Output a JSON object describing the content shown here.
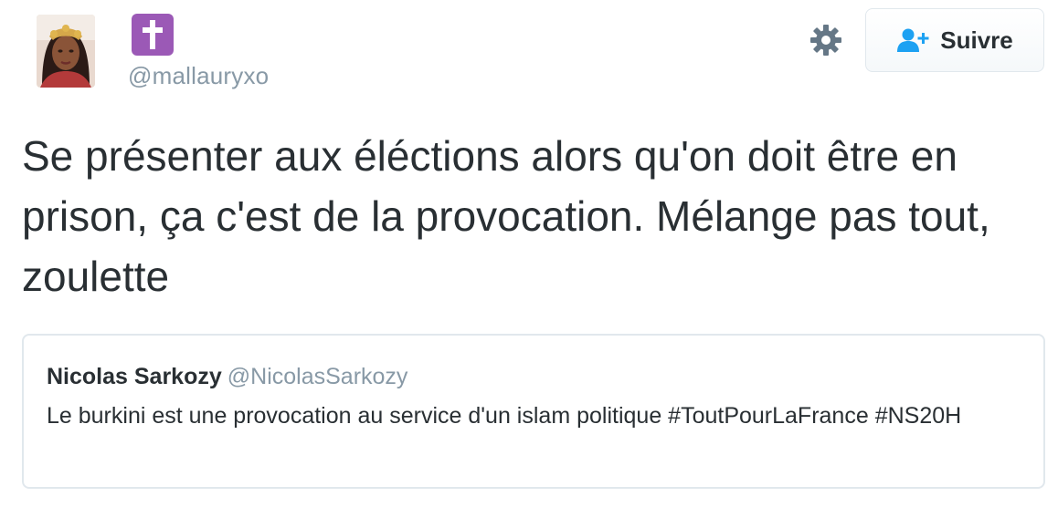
{
  "author": {
    "handle": "@mallauryxo",
    "name_emoji": "latin-cross-emoji"
  },
  "header": {
    "follow_label": "Suivre",
    "settings_icon": "gear-icon",
    "follow_icon": "add-user-icon"
  },
  "tweet": {
    "text": "Se présenter aux éléctions alors qu'on doit être en prison, ça c'est de la provocation. Mélange pas tout, zoulette"
  },
  "quoted_tweet": {
    "name": "Nicolas Sarkozy",
    "handle": "@NicolasSarkozy",
    "text": "Le burkini est une provocation au service d'un islam politique #ToutPourLaFrance #NS20H"
  },
  "colors": {
    "text": "#292f33",
    "muted": "#8899a6",
    "follow_icon": "#1da1f2",
    "emoji_bg": "#9b59b6",
    "border": "#e1e8ed"
  }
}
